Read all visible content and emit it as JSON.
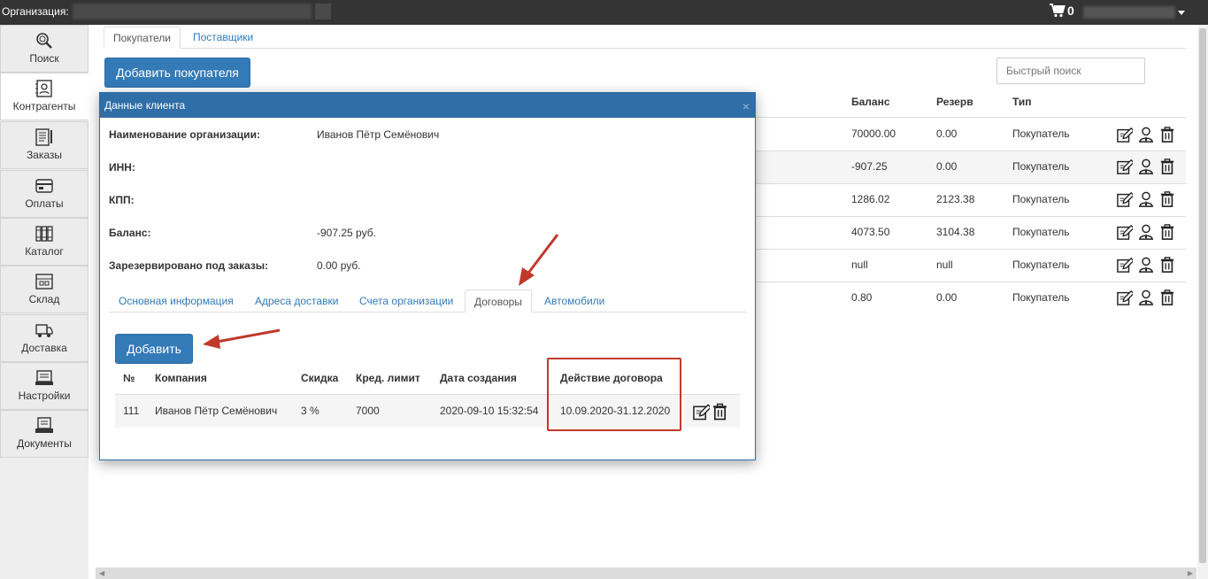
{
  "topbar": {
    "org_label": "Организация:",
    "cart_count": "0"
  },
  "sidebar": {
    "items": [
      {
        "label": "Поиск",
        "icon": "search-icon"
      },
      {
        "label": "Контрагенты",
        "icon": "contacts-icon"
      },
      {
        "label": "Заказы",
        "icon": "orders-icon"
      },
      {
        "label": "Оплаты",
        "icon": "payments-icon"
      },
      {
        "label": "Каталог",
        "icon": "catalog-icon"
      },
      {
        "label": "Склад",
        "icon": "warehouse-icon"
      },
      {
        "label": "Доставка",
        "icon": "delivery-icon"
      },
      {
        "label": "Настройки",
        "icon": "settings-icon"
      },
      {
        "label": "Документы",
        "icon": "documents-icon"
      }
    ]
  },
  "main": {
    "tabs": [
      {
        "label": "Покупатели",
        "active": true
      },
      {
        "label": "Поставщики",
        "active": false
      }
    ],
    "add_button": "Добавить покупателя",
    "search_placeholder": "Быстрый поиск",
    "table": {
      "headers": [
        "Баланс",
        "Резерв",
        "Тип"
      ],
      "rows": [
        [
          "70000.00",
          "0.00",
          "Покупатель"
        ],
        [
          "-907.25",
          "0.00",
          "Покупатель"
        ],
        [
          "1286.02",
          "2123.38",
          "Покупатель"
        ],
        [
          "4073.50",
          "3104.38",
          "Покупатель"
        ],
        [
          "null",
          "null",
          "Покупатель"
        ],
        [
          "0.80",
          "0.00",
          "Покупатель"
        ]
      ]
    }
  },
  "modal": {
    "title": "Данные клиента",
    "close": "×",
    "fields": [
      {
        "label": "Наименование организации:",
        "value": "Иванов Пётр Семёнович"
      },
      {
        "label": "ИНН:",
        "value": ""
      },
      {
        "label": "КПП:",
        "value": ""
      },
      {
        "label": "Баланс:",
        "value": "-907.25 руб."
      },
      {
        "label": "Зарезервировано под заказы:",
        "value": "0.00 руб."
      }
    ],
    "tabs": [
      {
        "label": "Основная информация",
        "active": false
      },
      {
        "label": "Адреса доставки",
        "active": false
      },
      {
        "label": "Счета организации",
        "active": false
      },
      {
        "label": "Договоры",
        "active": true
      },
      {
        "label": "Автомобили",
        "active": false
      }
    ],
    "add_button": "Добавить",
    "contracts": {
      "headers": [
        "№",
        "Компания",
        "Скидка",
        "Кред. лимит",
        "Дата создания",
        "Действие договора"
      ],
      "rows": [
        [
          "111",
          "Иванов Пётр Семёнович",
          "3 %",
          "7000",
          "2020-09-10 15:32:54",
          "10.09.2020-31.12.2020"
        ]
      ]
    }
  },
  "colors": {
    "primary": "#337ab7",
    "topbar": "#343434",
    "annotation": "#c0392b"
  }
}
